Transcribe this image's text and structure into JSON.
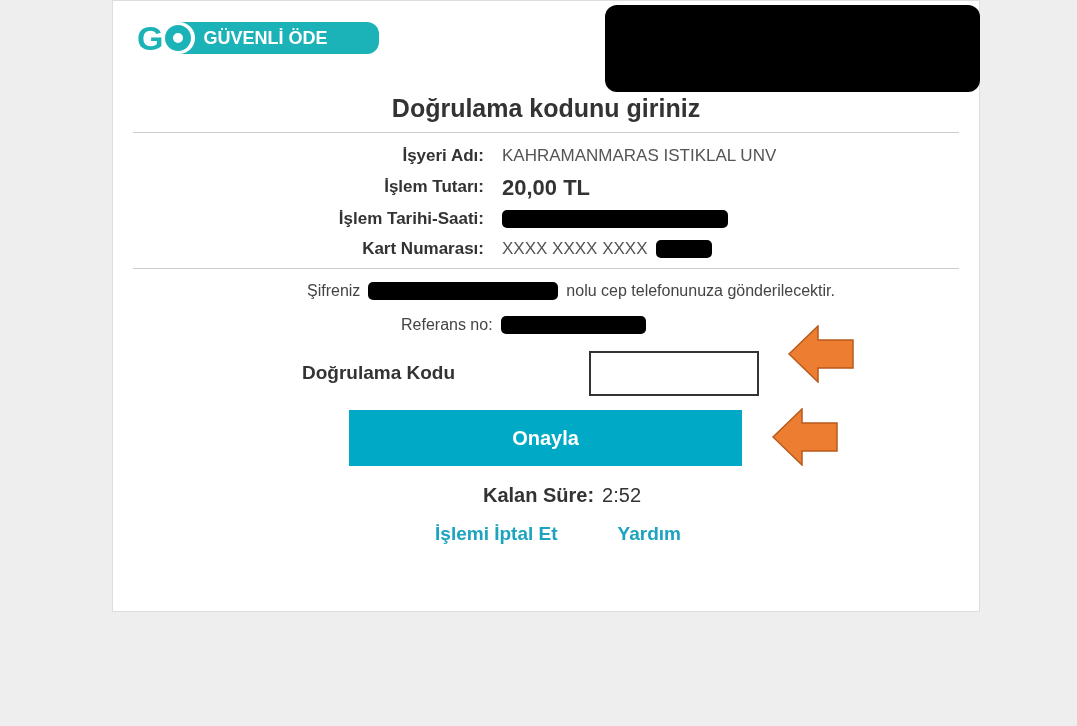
{
  "logo": {
    "letter": "G",
    "tagline": "GÜVENLİ ÖDE"
  },
  "title": "Doğrulama kodunu giriniz",
  "details": [
    {
      "label": "İşyeri Adı:",
      "value": "KAHRAMANMARAS ISTIKLAL UNV",
      "kind": "text",
      "redacted": false
    },
    {
      "label": "İşlem Tutarı:",
      "value": "20,00 TL",
      "kind": "amount",
      "redacted": false
    },
    {
      "label": "İşlem Tarihi-Saati:",
      "kind": "text",
      "redacted": true
    },
    {
      "label": "Kart Numarası:",
      "value": "XXXX XXXX XXXX",
      "kind": "text",
      "redacted": true
    }
  ],
  "notice": {
    "before": "Şifreniz",
    "after": "nolu cep telefonunuza gönderilecektir."
  },
  "reference": {
    "label": "Referans no:"
  },
  "code_field": {
    "label": "Doğrulama Kodu",
    "focused": true
  },
  "confirm_button": "Onayla",
  "timer": {
    "label": "Kalan Süre:",
    "value": "2:52"
  },
  "links": [
    "İşlemi İptal Et",
    "Yardım"
  ],
  "annotations": [
    {
      "kind": "arrow"
    },
    {
      "kind": "arrow"
    }
  ]
}
